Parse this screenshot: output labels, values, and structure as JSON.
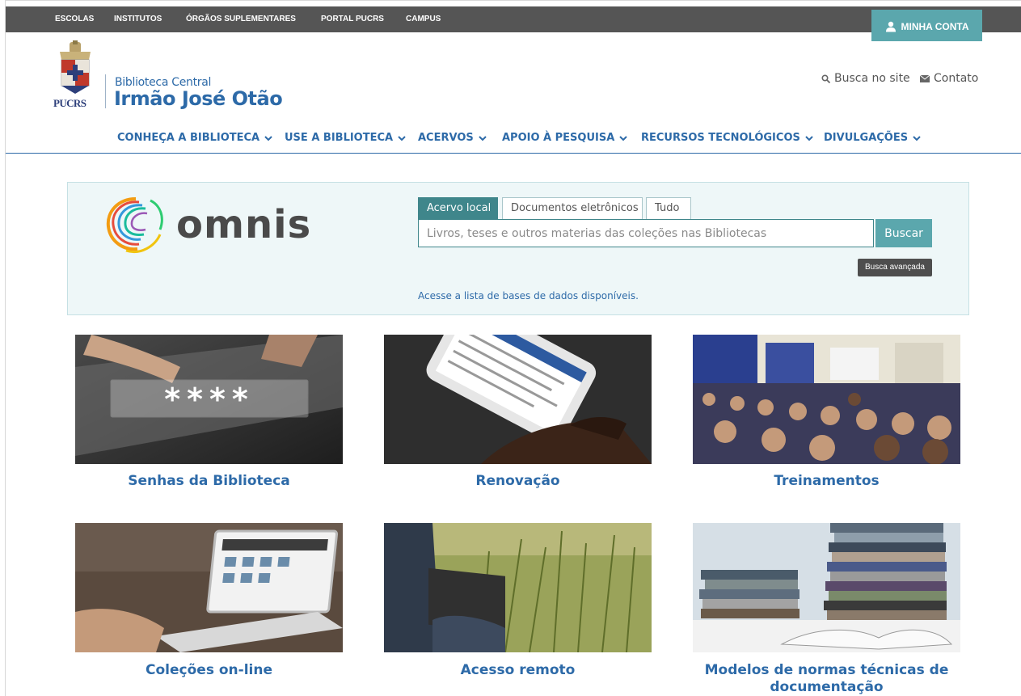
{
  "topbar": {
    "links": [
      "ESCOLAS",
      "INSTITUTOS",
      "ÓRGÃOS SUPLEMENTARES",
      "PORTAL PUCRS",
      "CAMPUS"
    ],
    "account_label": "MINHA CONTA"
  },
  "header": {
    "logo_acronym": "PUCRS",
    "subtitle": "Biblioteca Central",
    "title": "Irmão José Otão",
    "search_site_label": "Busca no site",
    "contact_label": "Contato"
  },
  "mainnav": {
    "items": [
      "CONHEÇA A BIBLIOTECA",
      "USE A BIBLIOTECA",
      "ACERVOS",
      "APOIO À PESQUISA",
      "RECURSOS TECNOLÓGICOS",
      "DIVULGAÇÕES"
    ]
  },
  "search": {
    "brand": "omnis",
    "tabs": [
      "Acervo local",
      "Documentos eletrônicos",
      "Tudo"
    ],
    "active_tab": "Acervo local",
    "placeholder": "Livros, teses e outros materias das coleções nas Bibliotecas",
    "value": "",
    "button_label": "Buscar",
    "advanced_label": "Busca avançada",
    "databases_link": "Acesse a lista de bases de dados disponíveis."
  },
  "cards": [
    {
      "title": "Senhas da Biblioteca",
      "image_text": "****"
    },
    {
      "title": "Renovação"
    },
    {
      "title": "Treinamentos"
    },
    {
      "title": "Coleções on-line"
    },
    {
      "title": "Acesso remoto"
    },
    {
      "title": "Modelos de normas técnicas de documentação"
    }
  ],
  "colors": {
    "topbar_bg": "#555555",
    "accent_teal": "#5ba7ad",
    "active_tab": "#3f868b",
    "link_blue": "#2d6aa8",
    "panel_bg": "#eef7f8"
  },
  "icons": {
    "account": "user-icon",
    "search_site": "magnifier-icon",
    "contact": "envelope-icon",
    "nav_caret": "chevron-down-icon"
  }
}
